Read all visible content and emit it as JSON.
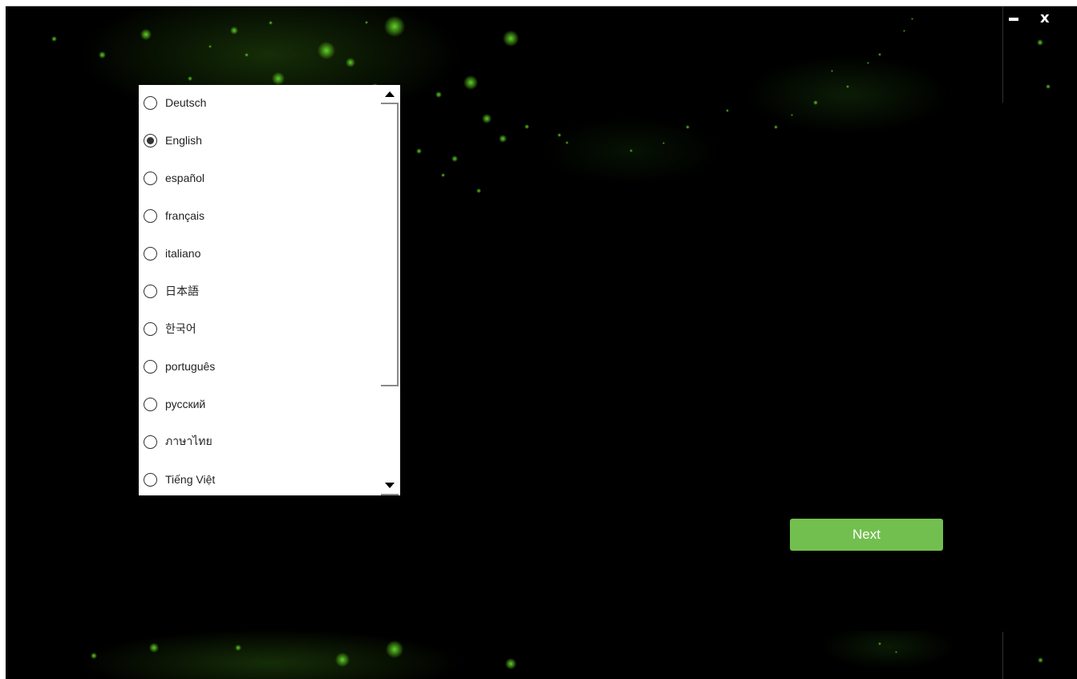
{
  "window": {
    "minimize_icon": "minimize-icon",
    "close_label": "x"
  },
  "language_list": {
    "selected": "English",
    "items": [
      {
        "label": "Deutsch",
        "checked": false
      },
      {
        "label": "English",
        "checked": true
      },
      {
        "label": "español",
        "checked": false
      },
      {
        "label": "français",
        "checked": false
      },
      {
        "label": "italiano",
        "checked": false
      },
      {
        "label": "日本語",
        "checked": false
      },
      {
        "label": "한국어",
        "checked": false
      },
      {
        "label": "português",
        "checked": false
      },
      {
        "label": "русский",
        "checked": false
      },
      {
        "label": "ภาษาไทย",
        "checked": false
      },
      {
        "label": "Tiếng Việt",
        "checked": false
      }
    ]
  },
  "actions": {
    "next_label": "Next"
  },
  "colors": {
    "accent": "#72bf4f",
    "background": "#000000",
    "bokeh_green": "#5fd12a"
  }
}
